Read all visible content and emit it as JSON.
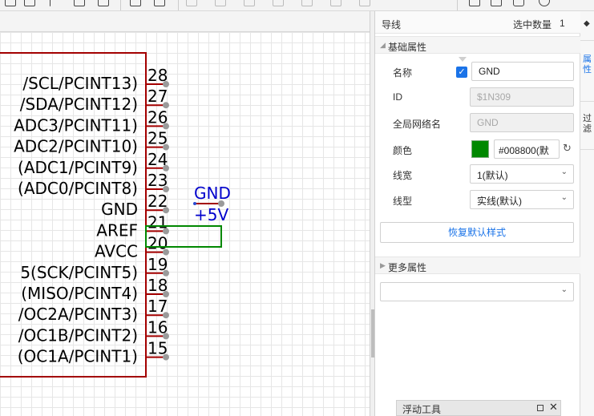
{
  "toolbar": {
    "icons": [
      "pointer-icon",
      "square-icon",
      "text-cursor-icon",
      "image-icon",
      "table-icon",
      "flip-horizontal-icon",
      "flip-vertical-icon",
      "align-left-icon",
      "align-center-icon",
      "align-right-icon",
      "distribute-icon",
      "screenshot-icon",
      "grid-icon",
      "cart-icon",
      "settings-icon"
    ]
  },
  "schematic": {
    "pins": [
      {
        "number": "28",
        "name": "/SCL/PCINT13)"
      },
      {
        "number": "27",
        "name": "/SDA/PCINT12)"
      },
      {
        "number": "26",
        "name": "ADC3/PCINT11)"
      },
      {
        "number": "25",
        "name": "ADC2/PCINT10)"
      },
      {
        "number": "24",
        "name": "(ADC1/PCINT9)"
      },
      {
        "number": "23",
        "name": "(ADC0/PCINT8)"
      },
      {
        "number": "22",
        "name": "GND"
      },
      {
        "number": "21",
        "name": "AREF"
      },
      {
        "number": "20",
        "name": "AVCC"
      },
      {
        "number": "19",
        "name": "5(SCK/PCINT5)"
      },
      {
        "number": "18",
        "name": "(MISO/PCINT4)"
      },
      {
        "number": "17",
        "name": "/OC2A/PCINT3)"
      },
      {
        "number": "16",
        "name": "/OC1B/PCINT2)"
      },
      {
        "number": "15",
        "name": "(OC1A/PCINT1)"
      }
    ],
    "net_labels": {
      "gnd": "GND",
      "vcc": "+5V"
    },
    "colors": {
      "body": "#a30000",
      "pin": "#a30000",
      "wire": "#008800",
      "net_label": "#0000cc"
    }
  },
  "panel": {
    "title": "导线",
    "selected_label": "选中数量",
    "selected_count": "1",
    "basic_section": "基础属性",
    "fields": {
      "name_label": "名称",
      "name_value": "GND",
      "name_checked": true,
      "id_label": "ID",
      "id_value": "$1N309",
      "net_label": "全局网络名",
      "net_value": "GND",
      "color_label": "颜色",
      "color_value": "#008800(默",
      "color_hex": "#008800",
      "width_label": "线宽",
      "width_value": "1(默认)",
      "style_label": "线型",
      "style_value": "实线(默认)"
    },
    "reset_button": "恢复默认样式",
    "more_section": "更多属性",
    "more_select_value": ""
  },
  "floating_tools": {
    "title": "浮动工具"
  },
  "right_tabs": {
    "properties": "属性",
    "filter": "过滤"
  }
}
